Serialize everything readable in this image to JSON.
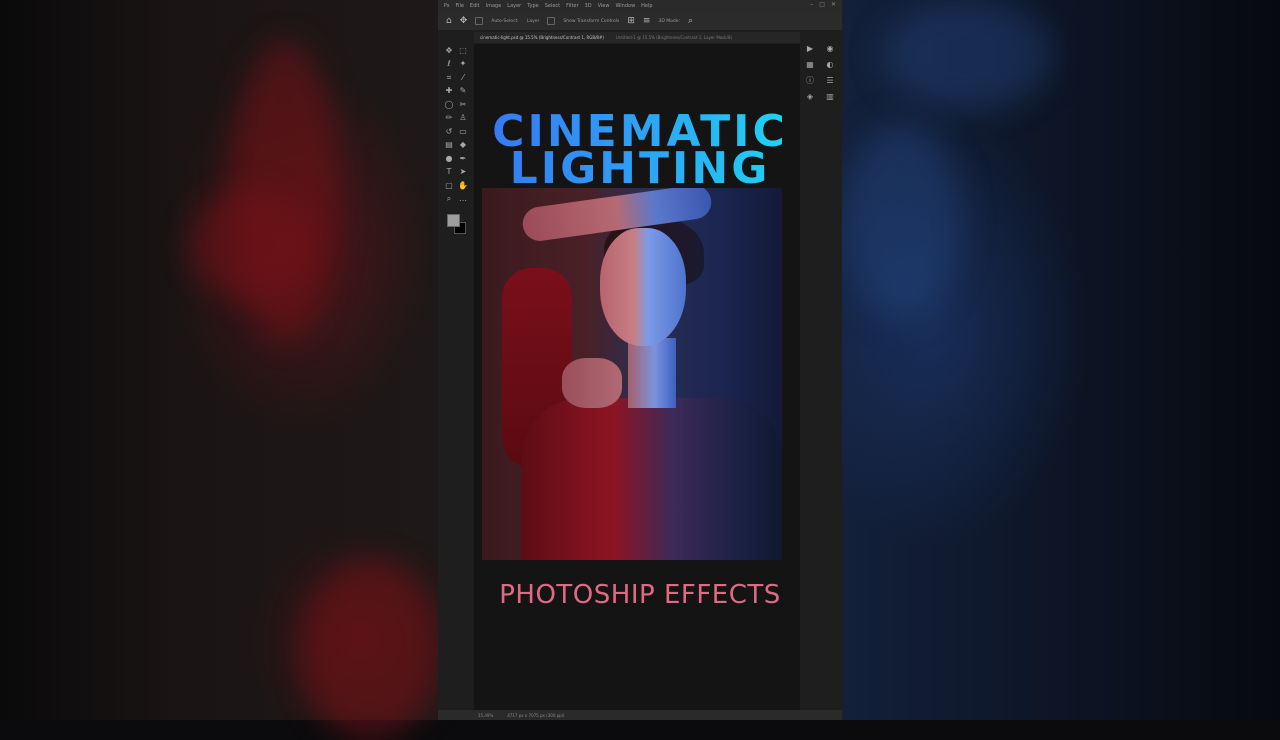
{
  "overlay": {
    "title_line1": "CINEMATIC",
    "title_line2": "LIGHTING",
    "subtitle": "PHOTOSHIP EFFECTS"
  },
  "photoshop": {
    "menu": [
      "Ps",
      "File",
      "Edit",
      "Image",
      "Layer",
      "Type",
      "Select",
      "Filter",
      "3D",
      "View",
      "Window",
      "Help"
    ],
    "document_tabs": [
      {
        "label": "cinematic-light.psd @ 15.5% (Brightness/Contrast 1, RGB/8#)",
        "active": true
      },
      {
        "label": "Untitled-1 @ 15.5% (Brightness/Contrast 1, Layer Mask/8)",
        "active": false
      }
    ],
    "options": {
      "auto_select_label": "Auto-Select:",
      "layer_label": "Layer",
      "transform_label": "Show Transform Controls",
      "mode_3d_label": "3D Mode:"
    },
    "status": {
      "zoom": "15.49%",
      "dimensions": "4717 px x 7075 px (300 ppi)"
    },
    "colors": {
      "foreground": "#9e9e9e",
      "background": "#000000"
    }
  },
  "colors": {
    "title_gradient_start": "#3a6cf0",
    "title_gradient_end": "#19e6f0",
    "subtitle": "#e06a84",
    "light_left": "#8d1422",
    "light_right": "#3d5fbf"
  }
}
